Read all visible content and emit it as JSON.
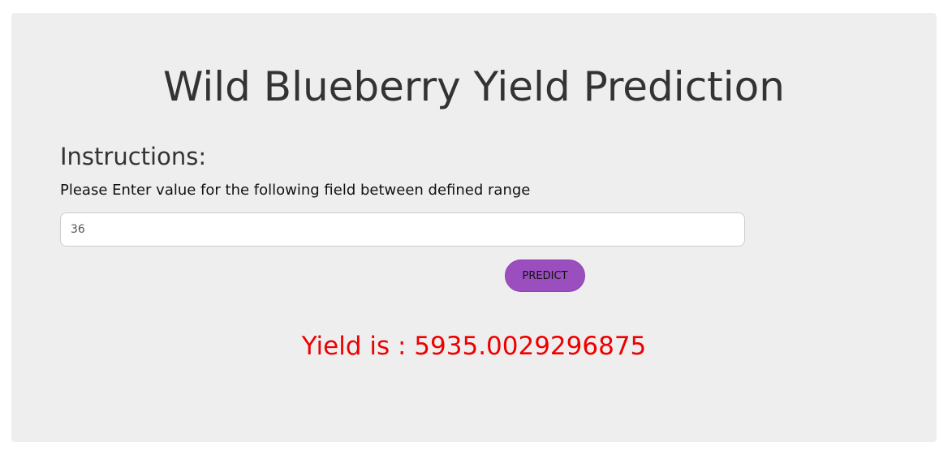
{
  "page": {
    "title": "Wild Blueberry Yield Prediction"
  },
  "instructions": {
    "heading": "Instructions:",
    "text": "Please Enter value for the following field between defined range"
  },
  "form": {
    "input_value": "36",
    "predict_label": "PREDICT"
  },
  "result": {
    "text": "Yield is : 5935.0029296875"
  },
  "colors": {
    "card_background": "#eeeeee",
    "button_accent": "#9b4fbf",
    "result_text": "#ee0000"
  }
}
